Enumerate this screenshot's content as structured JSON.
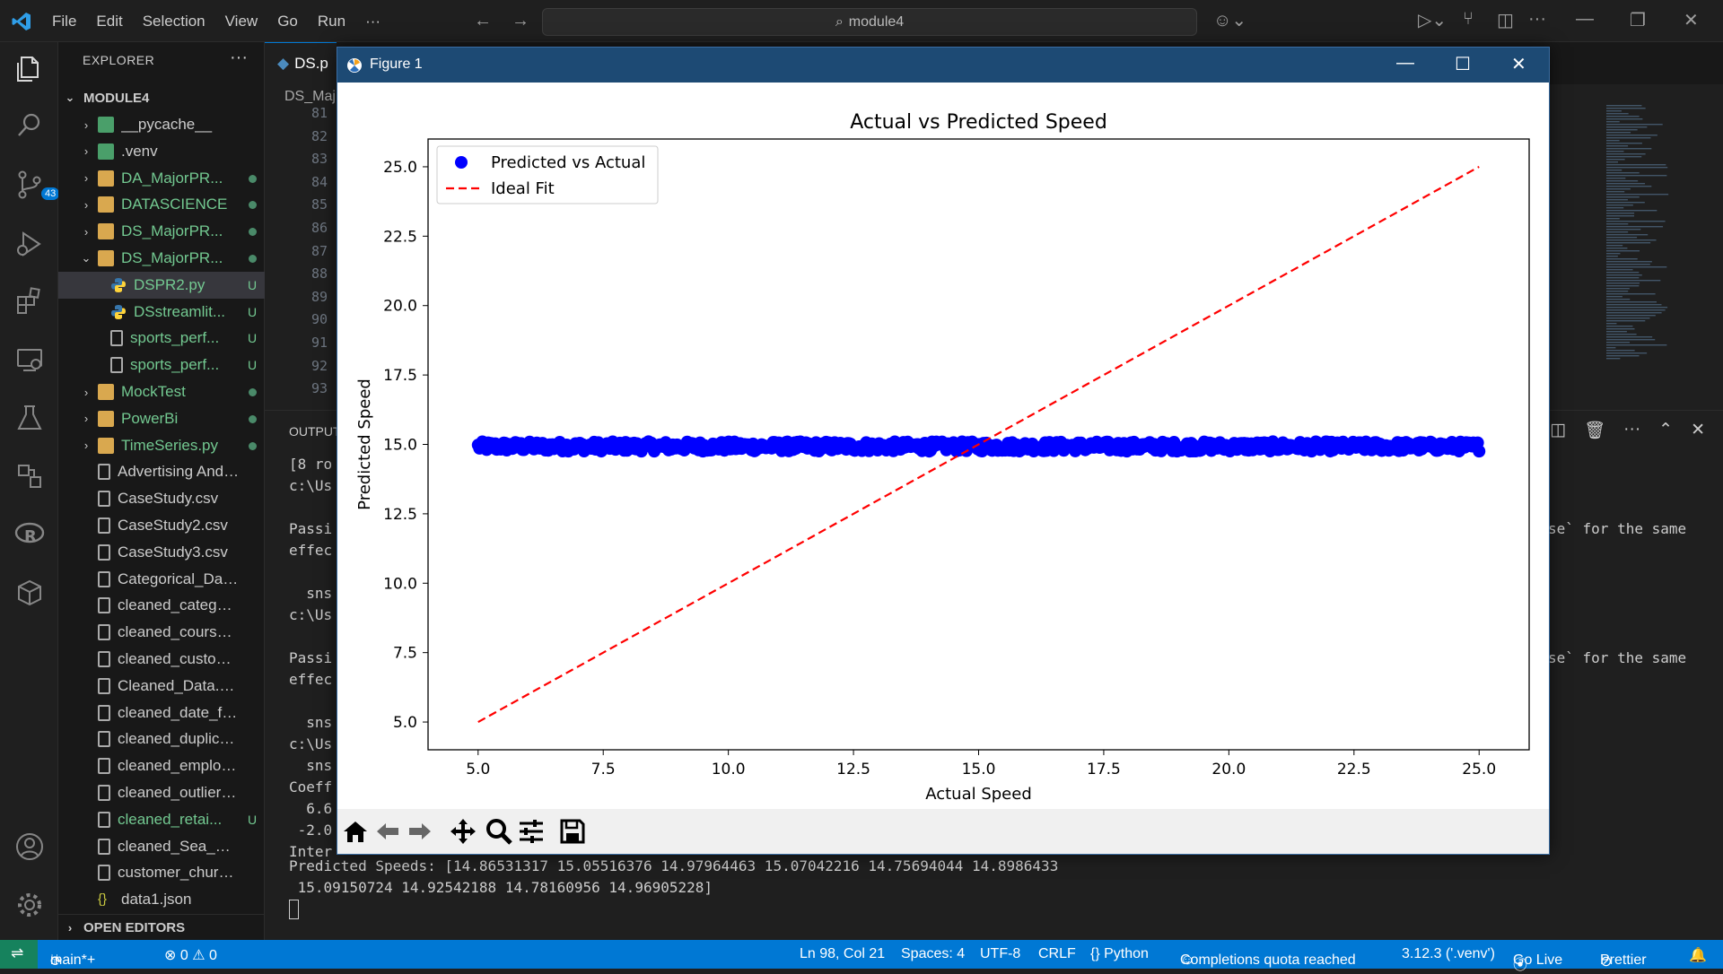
{
  "menu": [
    "File",
    "Edit",
    "Selection",
    "View",
    "Go",
    "Run",
    "···"
  ],
  "command_center": "module4",
  "activity_badge": "43",
  "explorer": {
    "title": "EXPLORER",
    "root": "MODULE4",
    "items": [
      {
        "label": "__pycache__",
        "type": "folder-py",
        "status": "",
        "chev": "›"
      },
      {
        "label": ".venv",
        "type": "folder-py",
        "status": "",
        "chev": "›"
      },
      {
        "label": "DA_MajorPR...",
        "type": "folder",
        "status": "dot",
        "chev": "›",
        "green": true
      },
      {
        "label": "DATASCIENCE",
        "type": "folder",
        "status": "dot",
        "chev": "›",
        "green": true
      },
      {
        "label": "DS_MajorPR...",
        "type": "folder",
        "status": "dot",
        "chev": "›",
        "green": true
      },
      {
        "label": "DS_MajorPR...",
        "type": "folder-open",
        "status": "dot",
        "chev": "⌄",
        "green": true
      },
      {
        "label": "DSPR2.py",
        "type": "py",
        "status": "U",
        "chev": "",
        "green": true,
        "indent": true,
        "selected": true
      },
      {
        "label": "DSstreamlit...",
        "type": "py",
        "status": "U",
        "chev": "",
        "green": true,
        "indent": true
      },
      {
        "label": "sports_perf...",
        "type": "file",
        "status": "U",
        "chev": "",
        "green": true,
        "indent": true
      },
      {
        "label": "sports_perf...",
        "type": "file",
        "status": "U",
        "chev": "",
        "green": true,
        "indent": true
      },
      {
        "label": "MockTest",
        "type": "folder",
        "status": "dot",
        "chev": "›",
        "green": true
      },
      {
        "label": "PowerBi",
        "type": "folder",
        "status": "dot",
        "chev": "›",
        "green": true
      },
      {
        "label": "TimeSeries.py",
        "type": "folder",
        "status": "dot",
        "chev": "›",
        "green": true
      },
      {
        "label": "Advertising And S...",
        "type": "file",
        "status": "",
        "chev": ""
      },
      {
        "label": "CaseStudy.csv",
        "type": "file",
        "status": "",
        "chev": ""
      },
      {
        "label": "CaseStudy2.csv",
        "type": "file",
        "status": "",
        "chev": ""
      },
      {
        "label": "CaseStudy3.csv",
        "type": "file",
        "status": "",
        "chev": ""
      },
      {
        "label": "Categorical_Data....",
        "type": "file",
        "status": "",
        "chev": ""
      },
      {
        "label": "cleaned_categorie...",
        "type": "file",
        "status": "",
        "chev": ""
      },
      {
        "label": "cleaned_course_e...",
        "type": "file",
        "status": "",
        "chev": ""
      },
      {
        "label": "cleaned_customer...",
        "type": "file",
        "status": "",
        "chev": ""
      },
      {
        "label": "Cleaned_Data.csv",
        "type": "file",
        "status": "",
        "chev": ""
      },
      {
        "label": "cleaned_date_for...",
        "type": "file",
        "status": "",
        "chev": ""
      },
      {
        "label": "cleaned_duplicate...",
        "type": "file",
        "status": "",
        "chev": ""
      },
      {
        "label": "cleaned_employe...",
        "type": "file",
        "status": "",
        "chev": ""
      },
      {
        "label": "cleaned_outliers.csv",
        "type": "file",
        "status": "",
        "chev": ""
      },
      {
        "label": "cleaned_retai...",
        "type": "file",
        "status": "U",
        "chev": "",
        "green": true
      },
      {
        "label": "cleaned_Sea_Case...",
        "type": "file",
        "status": "",
        "chev": ""
      },
      {
        "label": "customer_churn_d...",
        "type": "file",
        "status": "",
        "chev": ""
      },
      {
        "label": "data1.json",
        "type": "json",
        "status": "",
        "chev": ""
      }
    ],
    "open_editors": "OPEN EDITORS"
  },
  "editor": {
    "tab": "DS.p",
    "breadcrumb": "DS_Maj",
    "line_numbers": [
      "81",
      "82",
      "83",
      "84",
      "85",
      "86",
      "87",
      "88",
      "89",
      "90",
      "91",
      "92",
      "93"
    ]
  },
  "panel": {
    "title": "OUTPUT",
    "left_lines": [
      "[8 ro",
      "c:\\Us",
      "",
      "Passi",
      "effec",
      "",
      "  sns",
      "c:\\Us",
      "",
      "Passi",
      "effec",
      "",
      "  sns",
      "c:\\Us",
      "  sns",
      "Coeff",
      "  6.6",
      " -2.0",
      "Inter"
    ],
    "right_fragment_1": "se` for the same",
    "right_fragment_2": "se` for the same",
    "predicted_line_1": "Predicted Speeds: [14.86531317 15.05516376 14.97964463 15.07042216 14.75694044 14.8986433",
    "predicted_line_2": " 15.09150724 14.92542188 14.78160956 14.96905228]"
  },
  "status": {
    "branch": "main*+",
    "problems": "⊗ 0 ⚠ 0",
    "position": "Ln 98, Col 21",
    "spaces": "Spaces: 4",
    "encoding": "UTF-8",
    "eol": "CRLF",
    "language": "{} Python",
    "copilot": "Completions quota reached",
    "python_env": "3.12.3 ('.venv')",
    "golive": "Go Live",
    "prettier": "Prettier"
  },
  "figure": {
    "window_title": "Figure 1"
  },
  "chart_data": {
    "type": "scatter",
    "title": "Actual vs Predicted Speed",
    "xlabel": "Actual Speed",
    "ylabel": "Predicted Speed",
    "xlim": [
      4.0,
      26.0
    ],
    "ylim": [
      4.0,
      26.0
    ],
    "xticks": [
      "5.0",
      "7.5",
      "10.0",
      "12.5",
      "15.0",
      "17.5",
      "20.0",
      "22.5",
      "25.0"
    ],
    "yticks": [
      "5.0",
      "7.5",
      "10.0",
      "12.5",
      "15.0",
      "17.5",
      "20.0",
      "22.5",
      "25.0"
    ],
    "series": [
      {
        "name": "Predicted vs Actual",
        "kind": "scatter",
        "color": "#0000ff",
        "x_range": [
          5.0,
          25.0
        ],
        "y_range": [
          14.75,
          15.1
        ]
      },
      {
        "name": "Ideal Fit",
        "kind": "line",
        "color": "#ff0000",
        "style": "dashed",
        "x": [
          5.0,
          25.0
        ],
        "y": [
          5.0,
          25.0
        ]
      }
    ],
    "legend": "top-left",
    "grid": false
  }
}
